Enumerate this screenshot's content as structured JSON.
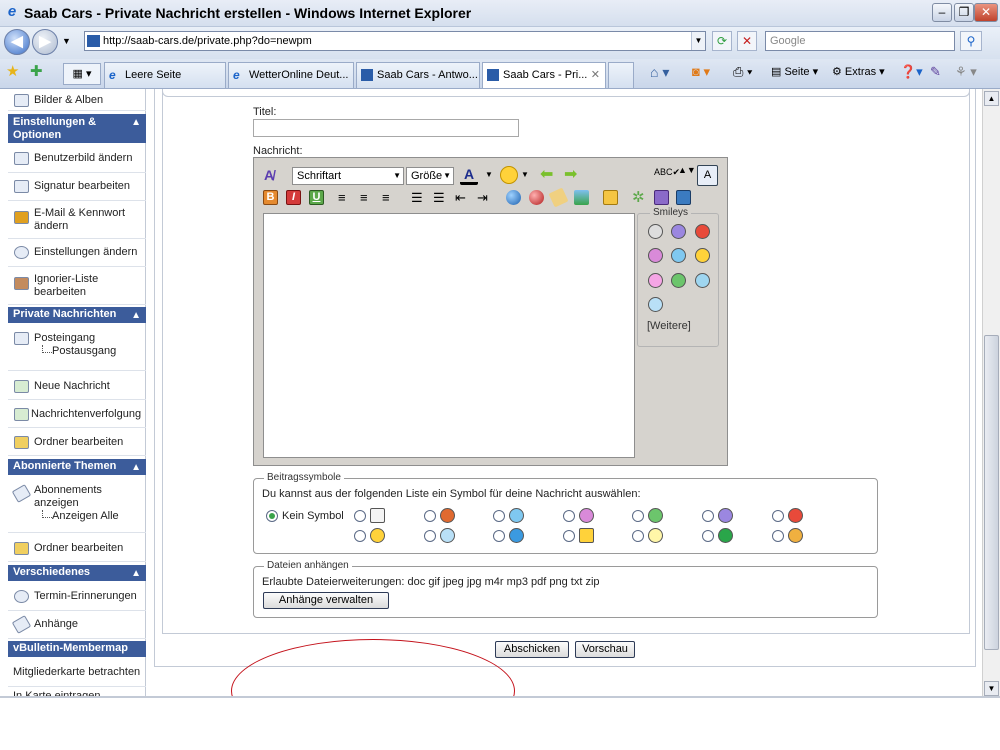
{
  "window": {
    "title": "Saab Cars - Private Nachricht erstellen - Windows Internet Explorer"
  },
  "address": {
    "url": "http://saab-cars.de/private.php?do=newpm"
  },
  "search": {
    "placeholder": "Google"
  },
  "tabs": [
    {
      "label": "Leere Seite",
      "icon": "ie-page-icon"
    },
    {
      "label": "WetterOnline Deut...",
      "icon": "ie-page-icon"
    },
    {
      "label": "Saab Cars - Antwo...",
      "icon": "saab-flag-icon"
    },
    {
      "label": "Saab Cars - Pri...",
      "icon": "saab-flag-icon",
      "active": true
    }
  ],
  "toolbar": {
    "seite": "Seite",
    "extras": "Extras"
  },
  "sidebar": {
    "bilder": "Bilder & Alben",
    "h_einstellungen": "Einstellungen & Optionen",
    "benutzerbild": "Benutzerbild ändern",
    "signatur": "Signatur bearbeiten",
    "email": "E-Mail & Kennwort ändern",
    "einstellungen": "Einstellungen ändern",
    "ignorier": "Ignorier-Liste bearbeiten",
    "h_private": "Private Nachrichten",
    "posteingang": "Posteingang",
    "postausgang": "Postausgang",
    "neue": "Neue Nachricht",
    "verfolgung": "Nachrichtenverfolgung",
    "ordner1": "Ordner bearbeiten",
    "h_abonnierte": "Abonnierte Themen",
    "abonnements": "Abonnements anzeigen",
    "alle": "Anzeigen Alle",
    "ordner2": "Ordner bearbeiten",
    "h_verschiedenes": "Verschiedenes",
    "termin": "Termin-Erinnerungen",
    "anhaenge": "Anhänge",
    "h_membermap": "vBulletin-Membermap",
    "mitglieder": "Mitgliederkarte betrachten",
    "karte": "In Karte eintragen"
  },
  "form": {
    "titel_label": "Titel:",
    "nachricht_label": "Nachricht:",
    "font_select": "Schriftart",
    "size_select": "Größe",
    "smileys_legend": "Smileys",
    "weitere": "[Weitere]",
    "beitrag_legend": "Beitragssymbole",
    "beitrag_text": "Du kannst aus der folgenden Liste ein Symbol für deine Nachricht auswählen:",
    "kein_symbol": "Kein Symbol",
    "dateien_legend": "Dateien anhängen",
    "erlaubte": "Erlaubte Dateierweiterungen: doc gif jpeg jpg m4r mp3 pdf png txt zip",
    "anhaenge_button": "Anhänge verwalten",
    "abschicken": "Abschicken",
    "vorschau": "Vorschau"
  },
  "colors": {
    "sidebar_header": "#3c5c9b",
    "annotation": "#c4121b"
  }
}
